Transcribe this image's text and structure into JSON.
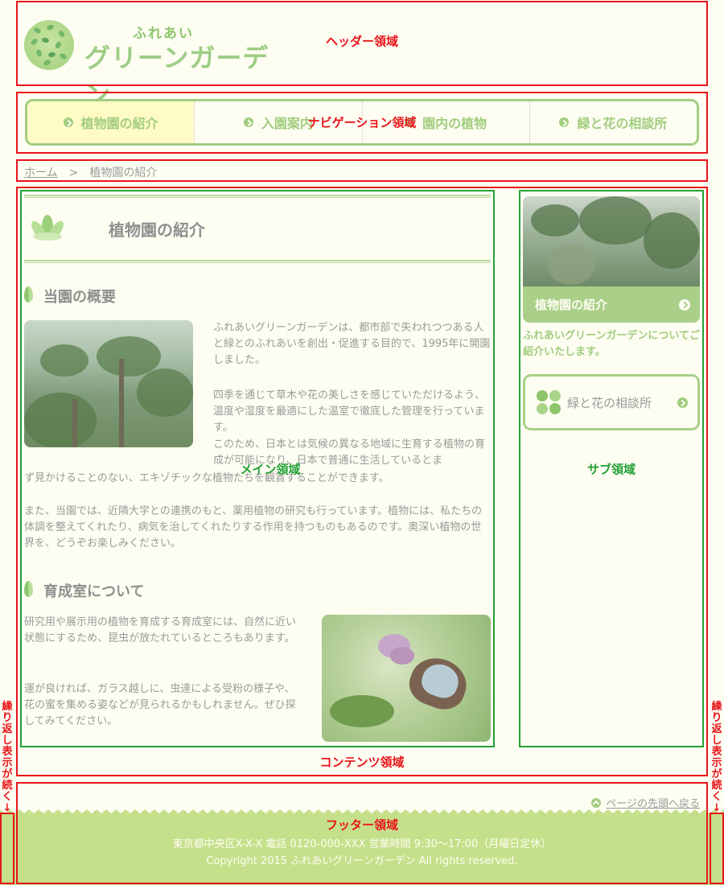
{
  "header": {
    "logo_small": "ふれあい",
    "logo_big": "グリーンガーデン"
  },
  "nav": {
    "items": [
      {
        "label": "植物園の紹介"
      },
      {
        "label": "入園案内"
      },
      {
        "label": "園内の植物"
      },
      {
        "label": "緑と花の相談所"
      }
    ]
  },
  "breadcrumb": {
    "home": "ホーム",
    "separator": ">",
    "current": "植物園の紹介"
  },
  "main": {
    "page_title": "植物園の紹介",
    "section1": {
      "heading": "当園の概要",
      "para1": "ふれあいグリーンガーデンは、都市部で失われつつある人と緑とのふれあいを創出・促進する目的で、1995年に開園しました。",
      "para2a": "四季を通じて草木や花の美しさを感じていただけるよう、温度や湿度を最適にした温室で徹底した管理を行っています。",
      "para2b_right": "このため、日本とは気候の異なる地域に生育する植物の育成が可能になり、日本で普通に生活しているとま",
      "para2b_full": "ず見かけることのない、エキゾチックな植物たちを観賞することができます。",
      "para3": "また、当園では、近隣大学との連携のもと、薬用植物の研究も行っています。植物には、私たちの体調を整えてくれたり、病気を治してくれたりする作用を持つものもあるのです。奥深い植物の世界を、どうぞお楽しみください。"
    },
    "section2": {
      "heading": "育成室について",
      "para1": "研究用や展示用の植物を育成する育成室には、自然に近い状態にするため、昆虫が放たれているところもあります。",
      "para2": "運が良ければ、ガラス越しに、虫達による受粉の様子や、花の蜜を集める姿などが見られるかもしれません。ぜひ探してみてください。"
    }
  },
  "sidebar": {
    "card_button": "植物園の紹介",
    "card_desc": "ふれあいグリーンガーデンについてご紹介いたします。",
    "consult_label": "緑と花の相談所"
  },
  "footer": {
    "back_to_top": "ページの先頭へ戻る",
    "address": "東京都中央区X-X-X 電話 0120-000-XXX 営業時間 9:30～17:00（月曜日定休）",
    "copyright": "Copyright 2015 ふれあいグリーンガーデン All rights reserved."
  },
  "annotations": {
    "header": "ヘッダー領域",
    "nav": "ナビゲーション領域",
    "content": "コンテンツ領域",
    "main": "メイン領域",
    "sub": "サブ領域",
    "footer": "フッター領域",
    "repeat": "繰り返し表示が続く↓"
  },
  "colors": {
    "background": "#fefdf2",
    "accent_green": "#a2cd7f",
    "nav_active_bg": "#fffbc4",
    "footer_green": "#c5e08b",
    "annotation_red": "#e8141a",
    "annotation_green": "#23a135"
  }
}
